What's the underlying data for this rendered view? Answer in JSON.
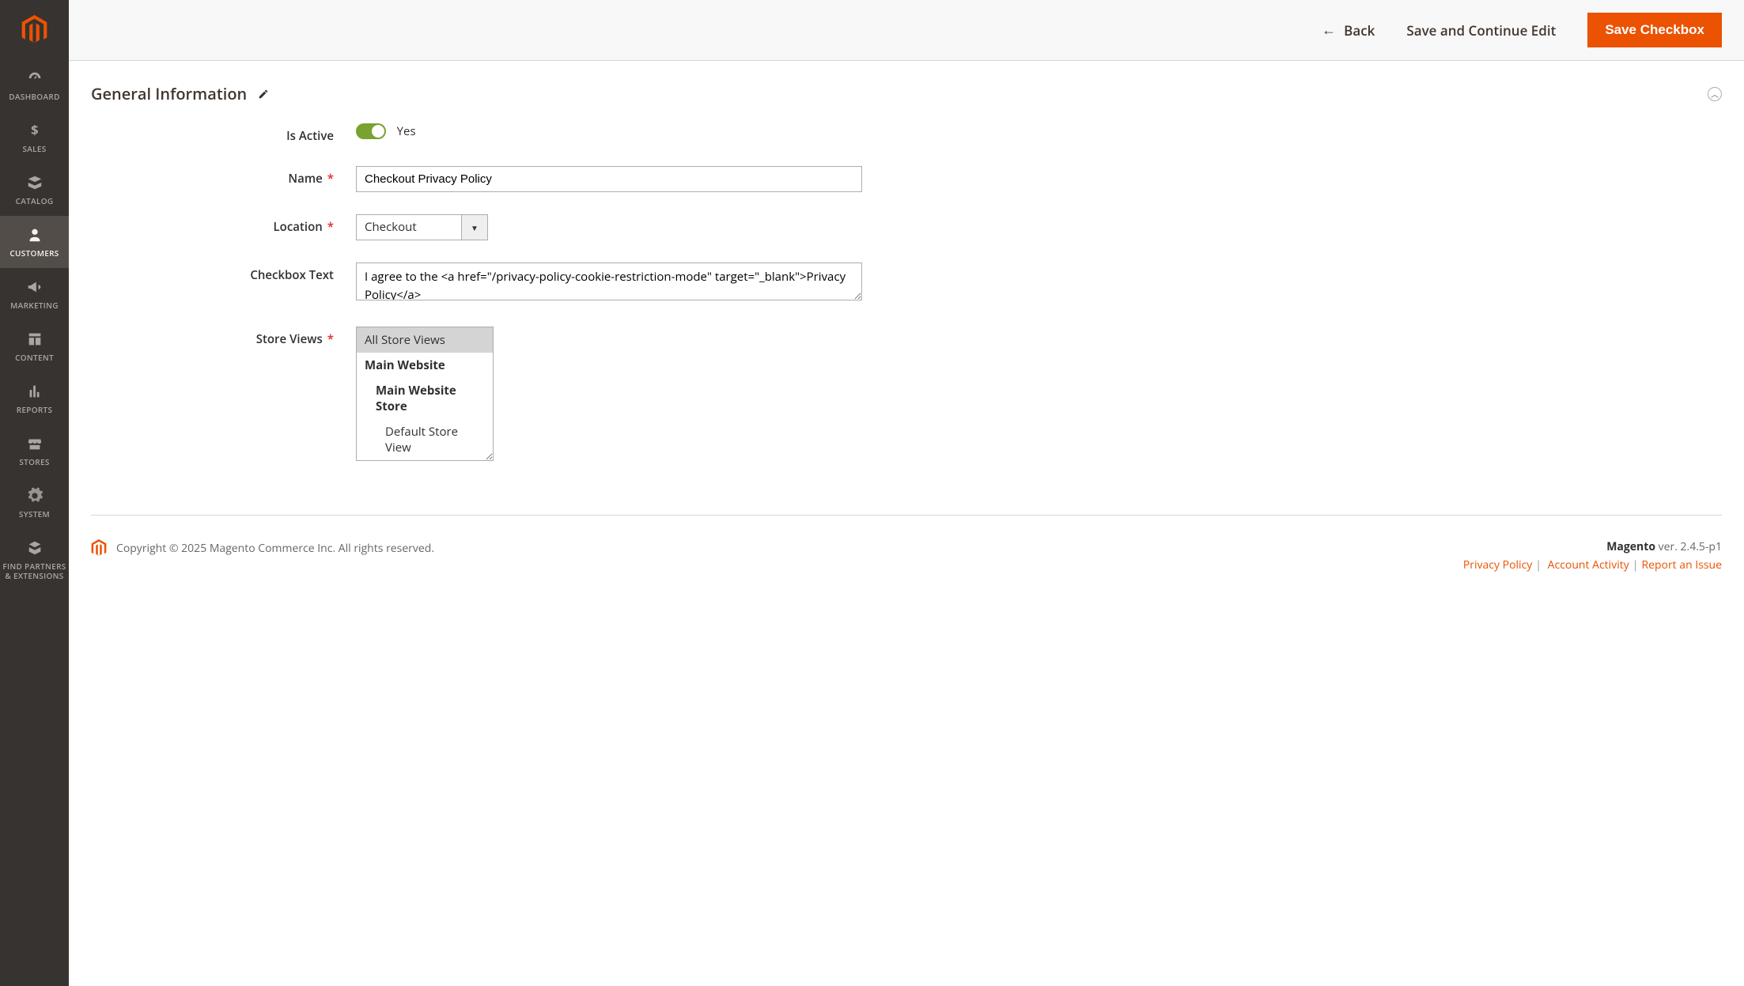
{
  "sidebar": {
    "items": [
      {
        "label": "DASHBOARD"
      },
      {
        "label": "SALES"
      },
      {
        "label": "CATALOG"
      },
      {
        "label": "CUSTOMERS"
      },
      {
        "label": "MARKETING"
      },
      {
        "label": "CONTENT"
      },
      {
        "label": "REPORTS"
      },
      {
        "label": "STORES"
      },
      {
        "label": "SYSTEM"
      },
      {
        "label": "FIND PARTNERS & EXTENSIONS"
      }
    ]
  },
  "actions": {
    "back": "Back",
    "save_continue": "Save and Continue Edit",
    "save": "Save Checkbox"
  },
  "section": {
    "title": "General Information"
  },
  "form": {
    "is_active": {
      "label": "Is Active",
      "value_label": "Yes",
      "value": true
    },
    "name": {
      "label": "Name",
      "value": "Checkout Privacy Policy"
    },
    "location": {
      "label": "Location",
      "value": "Checkout"
    },
    "checkbox_text": {
      "label": "Checkbox Text",
      "value": "I agree to the <a href=\"/privacy-policy-cookie-restriction-mode\" target=\"_blank\">Privacy Policy</a>"
    },
    "store_views": {
      "label": "Store Views",
      "options": [
        {
          "label": "All Store Views",
          "selected": true,
          "indent": 0,
          "bold": false
        },
        {
          "label": "Main Website",
          "selected": false,
          "indent": 0,
          "bold": true
        },
        {
          "label": "Main Website Store",
          "selected": false,
          "indent": 1,
          "bold": true
        },
        {
          "label": "Default Store View",
          "selected": false,
          "indent": 2,
          "bold": false
        }
      ]
    }
  },
  "footer": {
    "copyright": "Copyright © 2025 Magento Commerce Inc. All rights reserved.",
    "product": "Magento",
    "version": " ver. 2.4.5-p1",
    "links": {
      "privacy": "Privacy Policy",
      "activity": " Account Activity",
      "report": "Report an Issue"
    }
  },
  "colors": {
    "accent": "#eb5202",
    "toggle_on": "#79a22e",
    "sidebar_bg": "#373330"
  }
}
